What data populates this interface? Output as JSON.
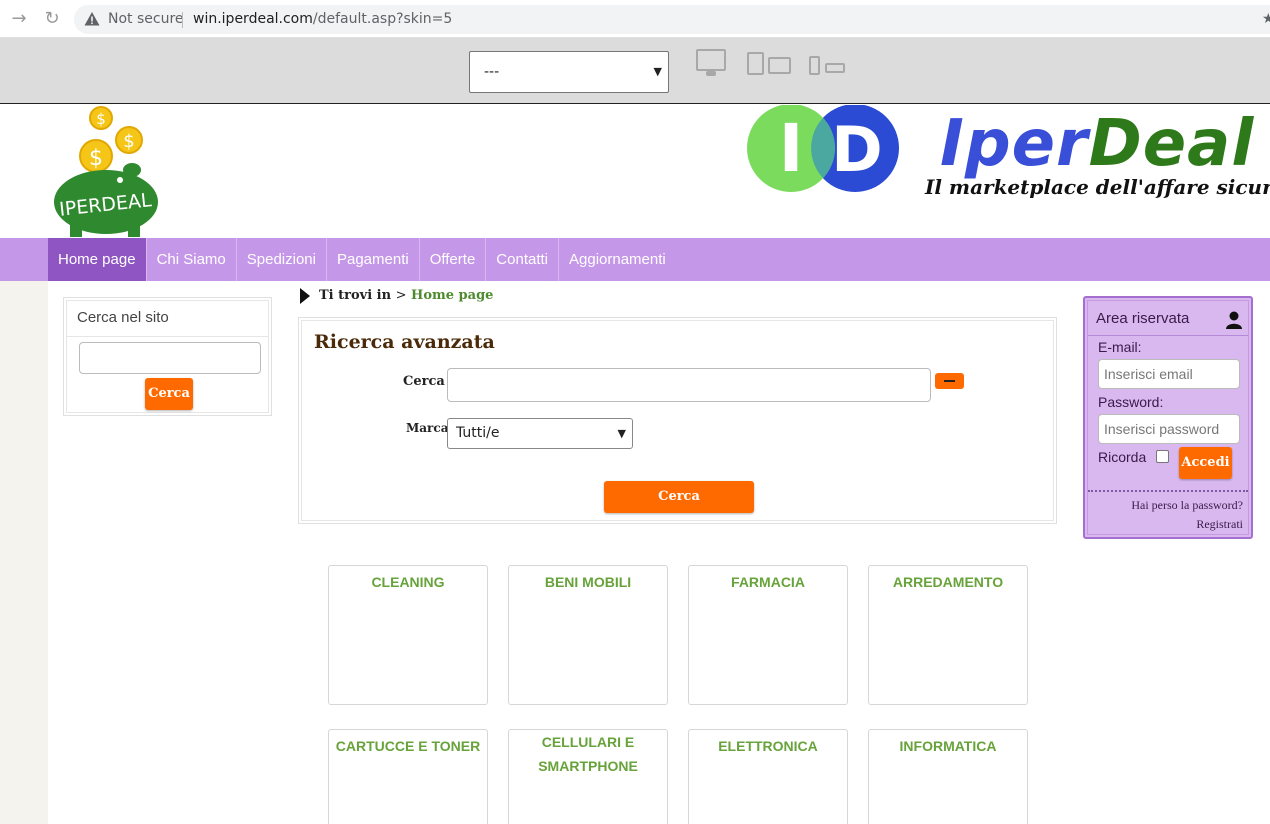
{
  "browser": {
    "not_secure": "Not secure",
    "url_domain": "win.iperdeal.com",
    "url_path": "/default.asp?skin=5"
  },
  "preview": {
    "select_value": "---"
  },
  "header": {
    "logo_text": "IPERDEAL",
    "brand_mark": "ID",
    "brand_title_1": "Iper",
    "brand_title_2": "Deal",
    "brand_subtitle": "Il marketplace dell'affare sicuro"
  },
  "nav": {
    "items": [
      "Home page",
      "Chi Siamo",
      "Spedizioni",
      "Pagamenti",
      "Offerte",
      "Contatti",
      "Aggiornamenti"
    ]
  },
  "site_search": {
    "title": "Cerca nel sito",
    "button": "Cerca"
  },
  "breadcrumb": {
    "label": "Ti trovi in",
    "sep": ">",
    "current": "Home page"
  },
  "adv_search": {
    "title": "Ricerca avanzata",
    "search_label": "Cerca",
    "brand_label": "Marca",
    "brand_value": "Tutti/e",
    "button": "Cerca"
  },
  "login": {
    "title": "Area riservata",
    "email_label": "E-mail:",
    "email_placeholder": "Inserisci email",
    "password_label": "Password:",
    "password_placeholder": "Inserisci password",
    "remember_label": "Ricorda",
    "submit": "Accedi",
    "forgot": "Hai perso la password?",
    "register": "Registrati"
  },
  "categories": [
    "CLEANING",
    "BENI MOBILI",
    "FARMACIA",
    "ARREDAMENTO",
    "CARTUCCE E TONER",
    "CELLULARI E SMARTPHONE",
    "ELETTRONICA",
    "INFORMATICA"
  ],
  "colors": {
    "nav_bg": "#c597e8",
    "nav_active": "#8f55c2",
    "accent_orange": "#ff6a00",
    "category_green": "#67a33a",
    "login_bg": "#d9b8f0"
  }
}
